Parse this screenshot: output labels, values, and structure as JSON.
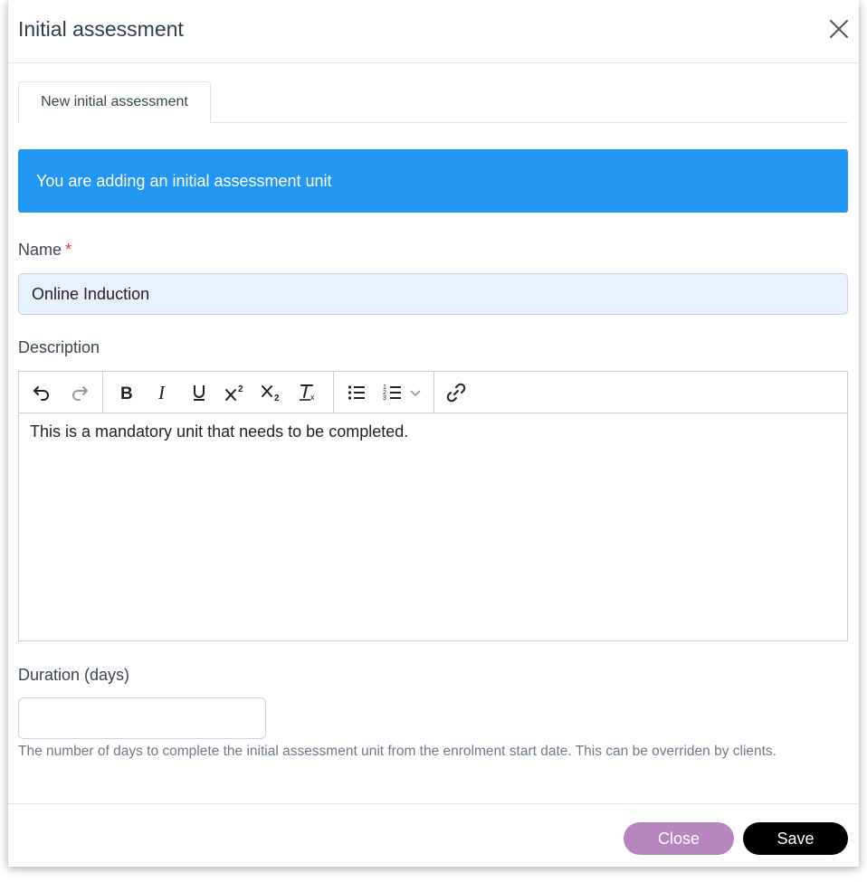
{
  "dialog": {
    "title": "Initial assessment",
    "close_icon": "close-icon"
  },
  "tabs": [
    {
      "label": "New initial assessment",
      "active": true
    }
  ],
  "banner": {
    "text": "You are adding an initial assessment unit",
    "color": "#2196f3"
  },
  "form": {
    "name": {
      "label": "Name",
      "required_marker": "*",
      "value": "Online Induction"
    },
    "description": {
      "label": "Description",
      "value": "This is a mandatory unit that needs to be completed."
    },
    "duration": {
      "label": "Duration (days)",
      "value": "",
      "help": "The number of days to complete the initial assessment unit from the enrolment start date. This can be overriden by clients."
    }
  },
  "toolbar": {
    "icons": [
      "undo-icon",
      "redo-icon",
      "bold-icon",
      "italic-icon",
      "underline-icon",
      "superscript-icon",
      "subscript-icon",
      "clear-formatting-icon",
      "bullet-list-icon",
      "numbered-list-icon",
      "chevron-down-icon",
      "link-icon"
    ]
  },
  "footer": {
    "close_label": "Close",
    "save_label": "Save",
    "close_color": "#b784c0",
    "save_color": "#000000"
  }
}
